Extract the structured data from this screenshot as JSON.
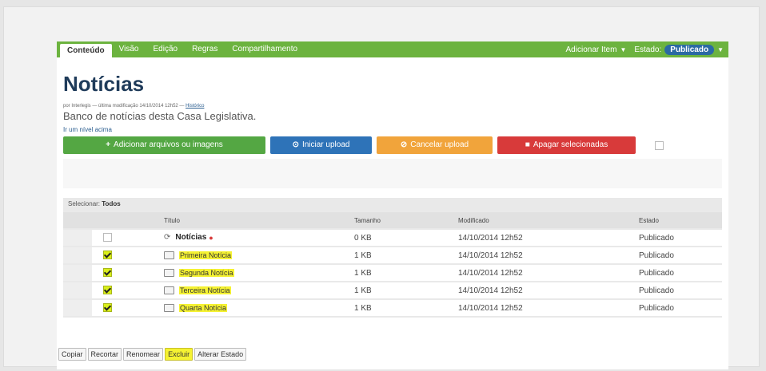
{
  "toolbar": {
    "tabs": [
      "Conteúdo",
      "Visão",
      "Edição",
      "Regras",
      "Compartilhamento"
    ],
    "add_item": "Adicionar Item",
    "state_label": "Estado:",
    "state_value": "Publicado"
  },
  "page": {
    "title": "Notícias",
    "byline_prefix": "por Interlegis — última modificação 14/10/2014 12h52 —",
    "byline_link": "Histórico",
    "description": "Banco de notícias desta Casa Legislativa.",
    "up_link": "Ir um nível acima"
  },
  "upload": {
    "add_label": "Adicionar arquivos ou imagens",
    "start_label": "Iniciar upload",
    "cancel_label": "Cancelar upload",
    "delete_label": "Apagar selecionadas",
    "colors": {
      "green": "#54a743",
      "blue": "#2e73b8",
      "orange": "#f1a43b",
      "red": "#d83a3a"
    }
  },
  "table": {
    "select_prefix": "Selecionar:",
    "select_all": "Todos",
    "headers": {
      "title": "Título",
      "size": "Tamanho",
      "modified": "Modificado",
      "state": "Estado"
    },
    "rows": [
      {
        "title": "Notícias",
        "size": "0 KB",
        "modified": "14/10/2014 12h52",
        "state": "Publicado",
        "checked": false,
        "icon": "sync-icon"
      },
      {
        "title": "Primeira Notícia",
        "size": "1 KB",
        "modified": "14/10/2014 12h52",
        "state": "Publicado",
        "checked": true,
        "icon": "folder-icon"
      },
      {
        "title": "Segunda Notícia",
        "size": "1 KB",
        "modified": "14/10/2014 12h52",
        "state": "Publicado",
        "checked": true,
        "icon": "folder-icon"
      },
      {
        "title": "Terceira Notícia",
        "size": "1 KB",
        "modified": "14/10/2014 12h52",
        "state": "Publicado",
        "checked": true,
        "icon": "folder-icon"
      },
      {
        "title": "Quarta Notícia",
        "size": "1 KB",
        "modified": "14/10/2014 12h52",
        "state": "Publicado",
        "checked": true,
        "icon": "folder-icon"
      }
    ]
  },
  "actions": [
    "Copiar",
    "Recortar",
    "Renomear",
    "Excluir",
    "Alterar Estado"
  ],
  "colors": {
    "toolbar": "#6cb33f",
    "highlight": "#f5f232",
    "title": "#1f3b5a"
  }
}
